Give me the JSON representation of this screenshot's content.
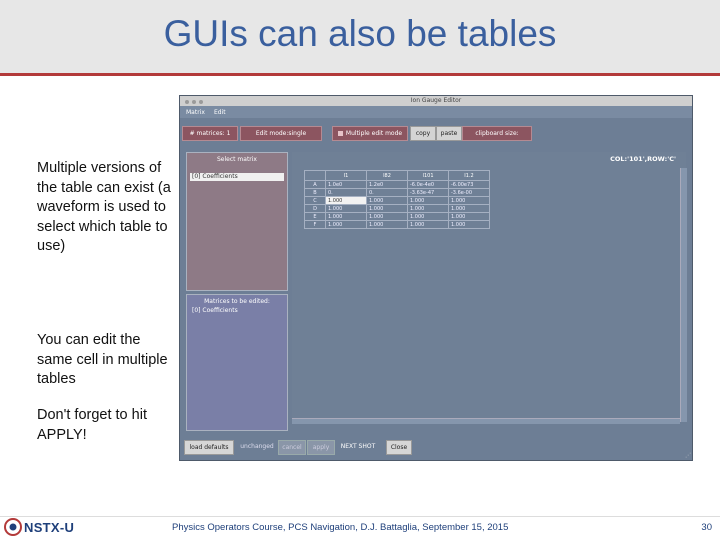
{
  "slide": {
    "title": "GUIs can also be tables",
    "notes": [
      "Multiple versions of the table can exist (a waveform is used to select which table to use)",
      "You can edit the same cell in multiple tables",
      "Don't forget to hit APPLY!"
    ],
    "footer": "Physics Operators Course, PCS Navigation, D.J. Battaglia, September 15, 2015",
    "page_number": "30",
    "logo_text": "NSTX-U"
  },
  "window": {
    "title": "Ion Gauge Editor",
    "menu": [
      "Matrix",
      "Edit"
    ],
    "toolbar": {
      "matrices_label": "# matrices: 1",
      "edit_mode_label": "Edit mode:single",
      "multiple_edit_label": "Multiple edit mode",
      "copy_label": "copy",
      "paste_label": "paste",
      "clipboard_label": "clipboard size:"
    },
    "select_panel": {
      "header": "Select matrix",
      "items": [
        "[0] Coefficients"
      ]
    },
    "edited_panel": {
      "header": "Matrices to be edited:",
      "items": [
        "[0] Coefficients"
      ]
    },
    "grid": {
      "col_row_readout": "COL:'101',ROW:'C'",
      "columns": [
        "I1",
        "I82",
        "I101",
        "I1.2"
      ],
      "rows": [
        {
          "label": "A",
          "cells": [
            "1.0e0",
            "1.2e0",
            "-6.0e-4e0",
            "-6.00e73"
          ]
        },
        {
          "label": "B",
          "cells": [
            "0.",
            "0.",
            "-3.63e-47",
            "-3.6e-00"
          ]
        },
        {
          "label": "C",
          "cells": [
            "1.000",
            "1.000",
            "1.000",
            "1.000"
          ]
        },
        {
          "label": "D",
          "cells": [
            "1.000",
            "1.000",
            "1.000",
            "1.000"
          ]
        },
        {
          "label": "E",
          "cells": [
            "1.000",
            "1.000",
            "1.000",
            "1.000"
          ]
        },
        {
          "label": "F",
          "cells": [
            "1.000",
            "1.000",
            "1.000",
            "1.000"
          ]
        }
      ]
    },
    "bottom": {
      "load_defaults": "load defaults",
      "status": "unchanged",
      "cancel": "cancel",
      "apply": "apply",
      "next_shot": "NEXT SHOT",
      "close": "Close"
    }
  },
  "colors": {
    "title_text": "#3a5f9e",
    "title_rule": "#b33a3a",
    "window_bg": "#6d7e95",
    "select_panel": "#8e7a86",
    "edited_panel": "#7a7fa7"
  }
}
